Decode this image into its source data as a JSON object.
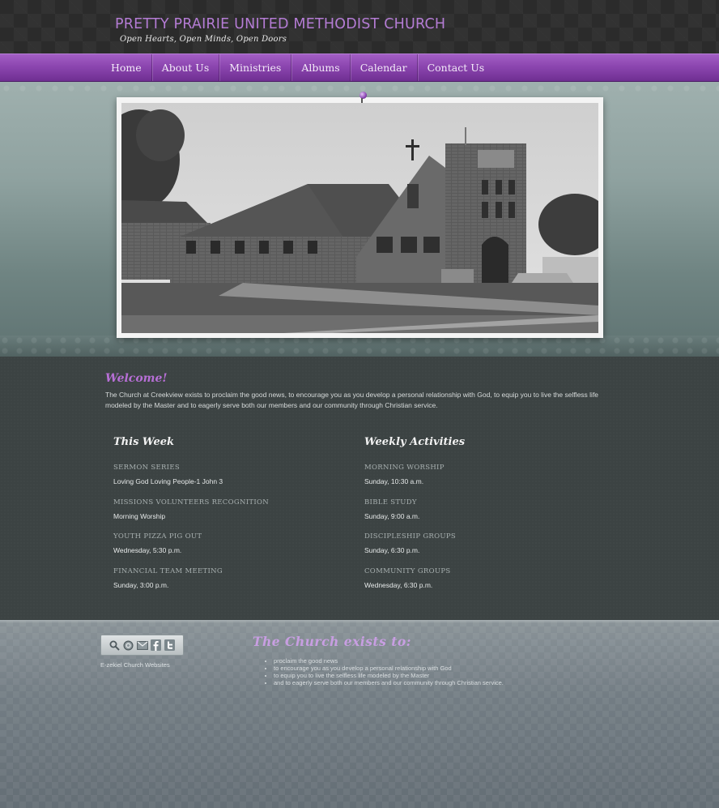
{
  "header": {
    "title": "PRETTY PRAIRIE UNITED METHODIST CHURCH",
    "tagline": "Open Hearts, Open Minds, Open Doors"
  },
  "nav": {
    "items": [
      {
        "label": "Home"
      },
      {
        "label": "About Us"
      },
      {
        "label": "Ministries"
      },
      {
        "label": "Albums"
      },
      {
        "label": "Calendar"
      },
      {
        "label": "Contact Us"
      }
    ]
  },
  "welcome": {
    "title": "Welcome!",
    "text": "The Church at Creekview exists to proclaim the good news, to encourage you as you develop a personal relationship with God, to equip you to live the selfless life modeled by the Master and to eagerly serve both our members and our community through Christian service."
  },
  "this_week": {
    "title": "This Week",
    "events": [
      {
        "name": "SERMON SERIES",
        "detail": "Loving God Loving People-1 John 3"
      },
      {
        "name": "MISSIONS VOLUNTEERS RECOGNITION",
        "detail": "Morning Worship"
      },
      {
        "name": "YOUTH PIZZA PIG OUT",
        "detail": "Wednesday, 5:30 p.m."
      },
      {
        "name": "FINANCIAL TEAM MEETING",
        "detail": "Sunday, 3:00 p.m."
      }
    ]
  },
  "weekly_activities": {
    "title": "Weekly Activities",
    "events": [
      {
        "name": "MORNING WORSHIP",
        "detail": "Sunday, 10:30 a.m."
      },
      {
        "name": "BIBLE STUDY",
        "detail": "Sunday, 9:00 a.m."
      },
      {
        "name": "DISCIPLESHIP GROUPS",
        "detail": "Sunday, 6:30 p.m."
      },
      {
        "name": "COMMUNITY GROUPS",
        "detail": "Wednesday, 6:30 p.m."
      }
    ]
  },
  "footer": {
    "icons": [
      "search-icon",
      "globe-icon",
      "email-icon",
      "facebook-icon",
      "twitter-icon"
    ],
    "credit": "E-zekiel Church Websites",
    "exists_title": "The Church exists to:",
    "exists_items": [
      "proclaim the good news",
      "to encourage you as you develop a personal relationship with God",
      "to equip you to live the selfless life modeled by the Master",
      "and to eagerly serve both our members and our community through Christian service."
    ]
  },
  "colors": {
    "accent_purple": "#8c46b0",
    "header_bg": "#2b2b2b",
    "main_bg": "#3c4343",
    "footer_bg": "#737e85"
  }
}
